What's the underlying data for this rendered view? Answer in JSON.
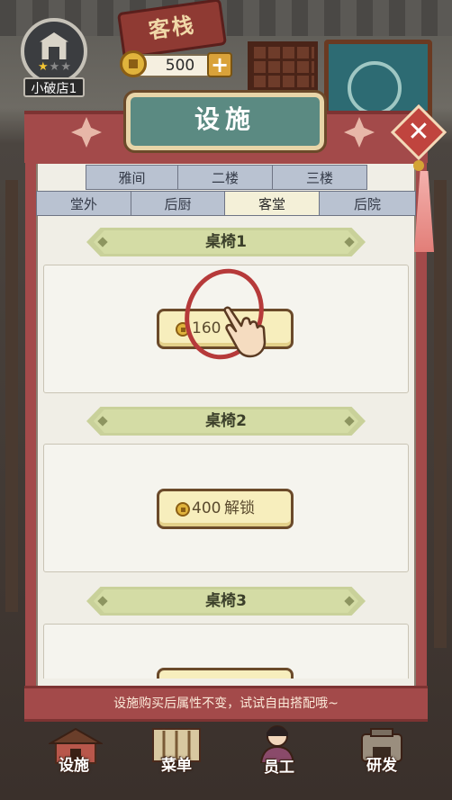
{
  "inn_sign": "客栈",
  "shop": {
    "name": "小破店1",
    "stars_filled": 1,
    "stars_total": 3,
    "icon": "shop-house-icon"
  },
  "coins": {
    "value": "500",
    "add_label": "+",
    "icon": "copper-coin-icon"
  },
  "panel": {
    "title": "设施",
    "close_label": "✕"
  },
  "tabs_row1": [
    {
      "label": "雅间",
      "active": false
    },
    {
      "label": "二楼",
      "active": false
    },
    {
      "label": "三楼",
      "active": false
    }
  ],
  "tabs_row2": [
    {
      "label": "堂外",
      "active": false
    },
    {
      "label": "后厨",
      "active": false
    },
    {
      "label": "客堂",
      "active": true
    },
    {
      "label": "后院",
      "active": false
    }
  ],
  "sections": [
    {
      "title": "桌椅1",
      "button": {
        "price": "160",
        "text": ""
      }
    },
    {
      "title": "桌椅2",
      "button": {
        "price": "400",
        "text": "解锁"
      }
    },
    {
      "title": "桌椅3",
      "button": {
        "price": "",
        "text": ""
      }
    }
  ],
  "tip": "设施购买后属性不变，试试自由搭配哦~",
  "bottom_nav": [
    {
      "label": "设施",
      "icon": "facility-icon"
    },
    {
      "label": "菜单",
      "icon": "menu-icon"
    },
    {
      "label": "员工",
      "icon": "staff-icon"
    },
    {
      "label": "研发",
      "icon": "research-icon"
    }
  ],
  "colors": {
    "panel_red": "#a34a4a",
    "title_teal": "#5b8a82",
    "section_green": "#c9d19a",
    "button_cream": "#f7eebd"
  }
}
